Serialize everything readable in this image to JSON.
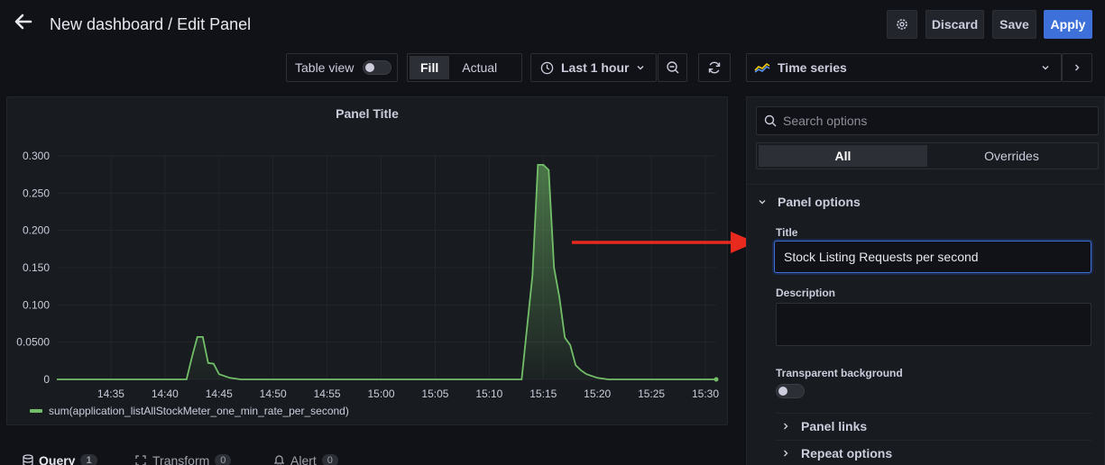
{
  "header": {
    "title": "New dashboard / Edit Panel",
    "back_icon": "arrow-left-icon",
    "settings_icon": "gear-icon",
    "discard_label": "Discard",
    "save_label": "Save",
    "apply_label": "Apply",
    "accent_color": "#3d71d9"
  },
  "toolbar": {
    "table_view_label": "Table view",
    "table_view_enabled": false,
    "fill_label": "Fill",
    "actual_label": "Actual",
    "time_range_label": "Last 1 hour",
    "clock_icon": "clock-icon",
    "zoom_out_icon": "zoom-out-icon",
    "refresh_icon": "refresh-icon",
    "viz_label": "Time series",
    "viz_icon": "time-series-icon"
  },
  "panel": {
    "title": "Panel Title"
  },
  "chart_data": {
    "type": "area",
    "series": [
      {
        "name": "sum(application_listAllStockMeter_one_min_rate_per_second)",
        "color": "#73bf69",
        "x": [
          "14:30",
          "14:40",
          "14:42",
          "14:42:30",
          "14:43",
          "14:43:30",
          "14:44",
          "14:44:30",
          "14:45",
          "14:46",
          "14:47",
          "14:50",
          "15:00",
          "15:13",
          "15:14",
          "15:14:30",
          "15:15",
          "15:15:30",
          "15:16",
          "15:16:30",
          "15:17",
          "15:17:30",
          "15:18",
          "15:18:30",
          "15:19",
          "15:20",
          "15:21",
          "15:31"
        ],
        "values": [
          0,
          0,
          0,
          0.03,
          0.057,
          0.057,
          0.022,
          0.021,
          0.007,
          0.002,
          0,
          0,
          0,
          0,
          0.14,
          0.288,
          0.288,
          0.281,
          0.15,
          0.11,
          0.056,
          0.046,
          0.019,
          0.012,
          0.007,
          0.002,
          0,
          0
        ]
      }
    ],
    "xticks": [
      "14:35",
      "14:40",
      "14:45",
      "14:50",
      "14:55",
      "15:00",
      "15:05",
      "15:10",
      "15:15",
      "15:20",
      "15:25",
      "15:30"
    ],
    "yticks": [
      "0",
      "0.0500",
      "0.100",
      "0.150",
      "0.200",
      "0.250",
      "0.300"
    ],
    "xlim": [
      "14:30",
      "15:31"
    ],
    "ylim": [
      0,
      0.3
    ],
    "grid": true,
    "legend_position": "bottom-left"
  },
  "bottom_tabs": [
    {
      "label": "Query",
      "count": "1",
      "icon": "database-icon"
    },
    {
      "label": "Transform",
      "count": "0",
      "icon": "transform-icon"
    },
    {
      "label": "Alert",
      "count": "0",
      "icon": "bell-icon"
    }
  ],
  "options": {
    "search_placeholder": "Search options",
    "search_icon": "search-icon",
    "tab_all": "All",
    "tab_overrides": "Overrides",
    "panel_options_label": "Panel options",
    "title_label": "Title",
    "title_value": "Stock Listing Requests per second",
    "description_label": "Description",
    "description_value": "",
    "transparent_label": "Transparent background",
    "transparent_enabled": false,
    "panel_links_label": "Panel links",
    "repeat_options_label": "Repeat options"
  },
  "annotation": {
    "arrow_color": "#e8291e"
  }
}
